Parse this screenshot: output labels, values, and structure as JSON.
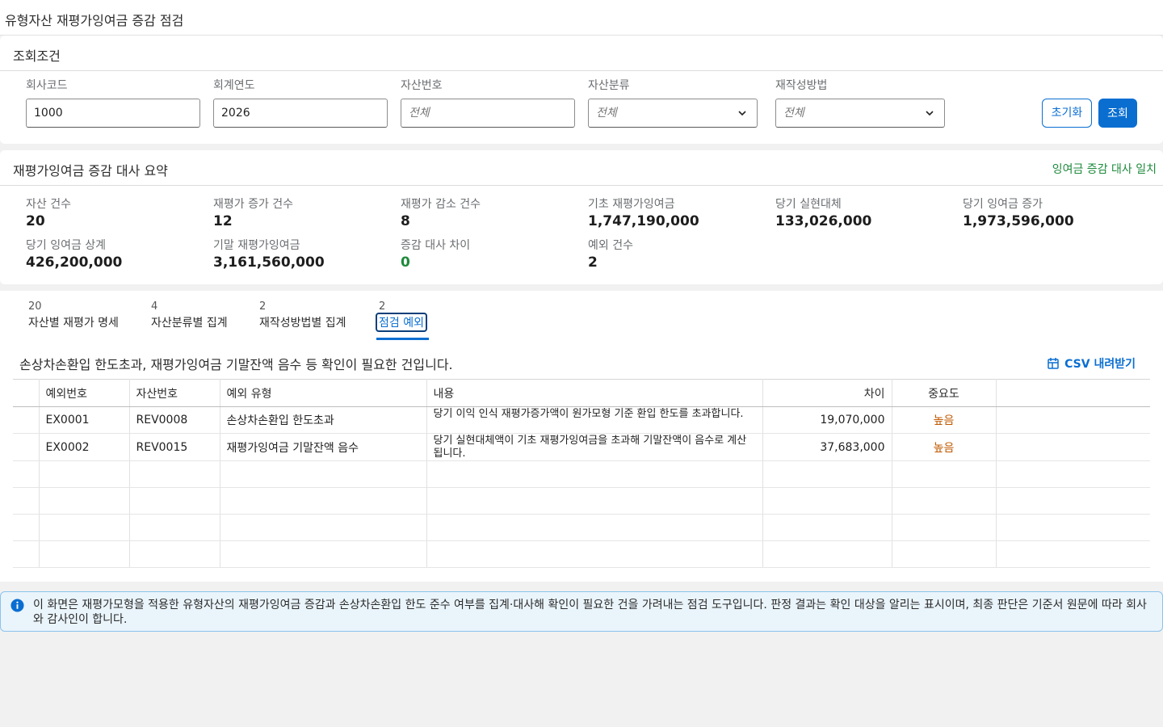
{
  "window": {
    "title": "유형자산 재평가잉여금 증감 점검"
  },
  "search": {
    "title": "조회조건",
    "company_code_label": "회사코드",
    "company_code": "1000",
    "fiscal_year_label": "회계연도",
    "fiscal_year": "2026",
    "asset_no_label": "자산번호",
    "asset_no_placeholder": "전체",
    "asset_class_label": "자산분류",
    "asset_class_value": "전체",
    "method_label": "재작성방법",
    "method_value": "전체",
    "reset_label": "초기화",
    "search_label": "조회"
  },
  "summary": {
    "title": "재평가잉여금 증감 대사 요약",
    "status": "잉여금 증감 대사 일치",
    "kpis": [
      {
        "label": "자산 건수",
        "value": "20"
      },
      {
        "label": "재평가 증가 건수",
        "value": "12"
      },
      {
        "label": "재평가 감소 건수",
        "value": "8"
      },
      {
        "label": "기초 재평가잉여금",
        "value": "1,747,190,000"
      },
      {
        "label": "당기 실현대체",
        "value": "133,026,000"
      },
      {
        "label": "당기 잉여금 증가",
        "value": "1,973,596,000"
      },
      {
        "label": "당기 잉여금 상계",
        "value": "426,200,000"
      },
      {
        "label": "기말 재평가잉여금",
        "value": "3,161,560,000"
      },
      {
        "label": "증감 대사 차이",
        "value": "0"
      },
      {
        "label": "예외 건수",
        "value": "2"
      }
    ]
  },
  "tabs": [
    {
      "count": "20",
      "label": "자산별 재평가 명세"
    },
    {
      "count": "4",
      "label": "자산분류별 집계"
    },
    {
      "count": "2",
      "label": "재작성방법별 집계"
    },
    {
      "count": "2",
      "label": "점검 예외"
    }
  ],
  "exceptions": {
    "description": "손상차손환입 한도초과, 재평가잉여금 기말잔액 음수 등 확인이 필요한 건입니다.",
    "csv_label": "CSV 내려받기",
    "columns": [
      "예외번호",
      "자산번호",
      "예외 유형",
      "내용",
      "차이",
      "중요도"
    ],
    "rows": [
      {
        "id": "EX0001",
        "asset": "REV0008",
        "type": "손상차손환입 한도초과",
        "content": "당기 이익 인식 재평가증가액이 원가모형 기준 환입 한도를 초과합니다.",
        "diff": "19,070,000",
        "severity": "높음"
      },
      {
        "id": "EX0002",
        "asset": "REV0015",
        "type": "재평가잉여금 기말잔액 음수",
        "content": "당기 실현대체액이 기초 재평가잉여금을 초과해 기말잔액이 음수로 계산됩니다.",
        "diff": "37,683,000",
        "severity": "높음"
      }
    ]
  },
  "info": {
    "text": "이 화면은 재평가모형을 적용한 유형자산의 재평가잉여금 증감과 손상차손환입 한도 준수 여부를 집계·대사해 확인이 필요한 건을 가려내는 점검 도구입니다. 판정 결과는 확인 대상을 알리는 표시이며, 최종 판단은 기준서 원문에 따라 회사와 감사인이 합니다."
  }
}
